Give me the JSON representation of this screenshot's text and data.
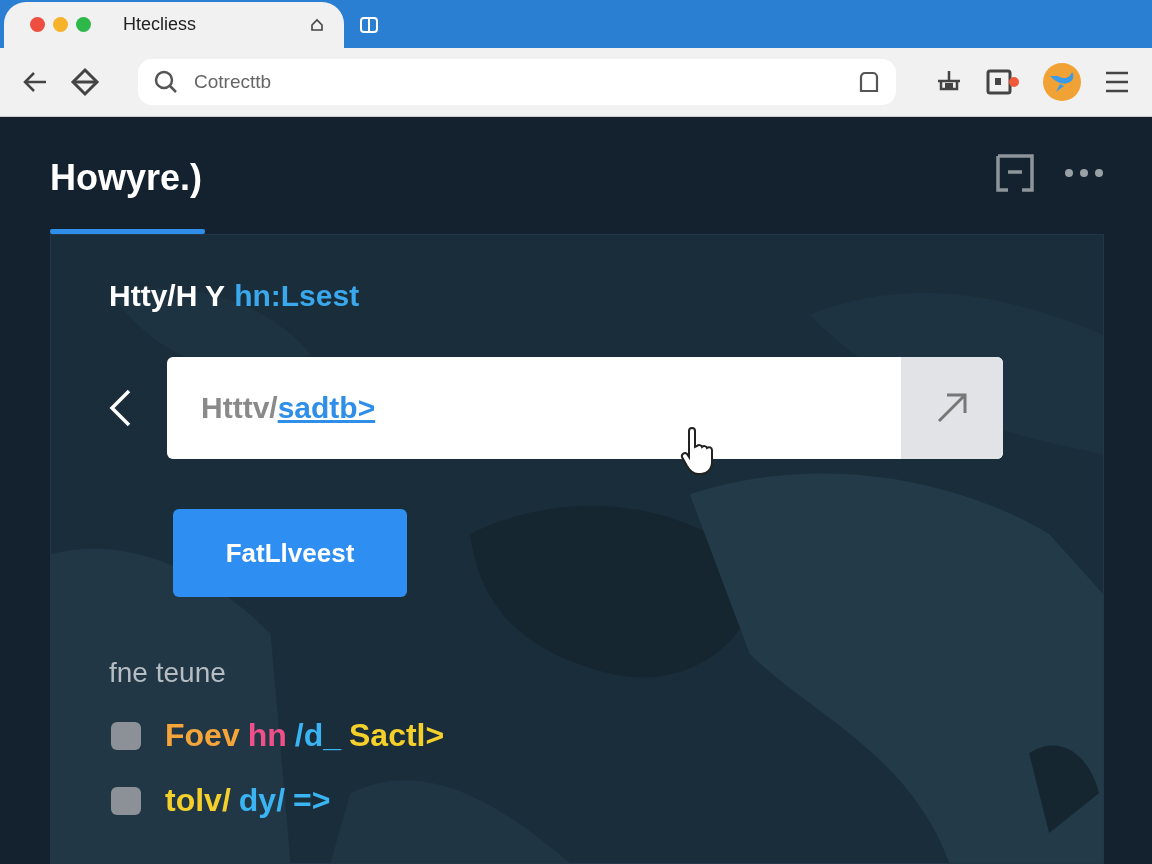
{
  "browser": {
    "tabs": [
      {
        "title": "Htecliess",
        "selected": true
      }
    ],
    "address_bar": {
      "value": "Cotrecttb"
    }
  },
  "page": {
    "title": "Howyre.)",
    "panel": {
      "heading": [
        {
          "text": "Htty/H Y",
          "color": "#ffffff"
        },
        {
          "text": "hn:Lsest",
          "color": "#3aa8ec"
        }
      ],
      "url_field": {
        "prefix": "Htttv/",
        "link": "sadtb>"
      },
      "button": "FatLlveest",
      "section_label": "fne teune",
      "items": [
        {
          "segments": [
            {
              "text": "Foev",
              "color": "#f5a53a"
            },
            {
              "text": "hn",
              "color": "#f0508a"
            },
            {
              "text": "/d_",
              "color": "#3ab4f2"
            },
            {
              "text": "Sactl>",
              "color": "#f5d02a"
            }
          ]
        },
        {
          "segments": [
            {
              "text": "tolv/",
              "color": "#f5d02a"
            },
            {
              "text": "dy/",
              "color": "#3ab4f2"
            },
            {
              "text": "=>",
              "color": "#3ab4f2"
            }
          ]
        }
      ]
    }
  }
}
